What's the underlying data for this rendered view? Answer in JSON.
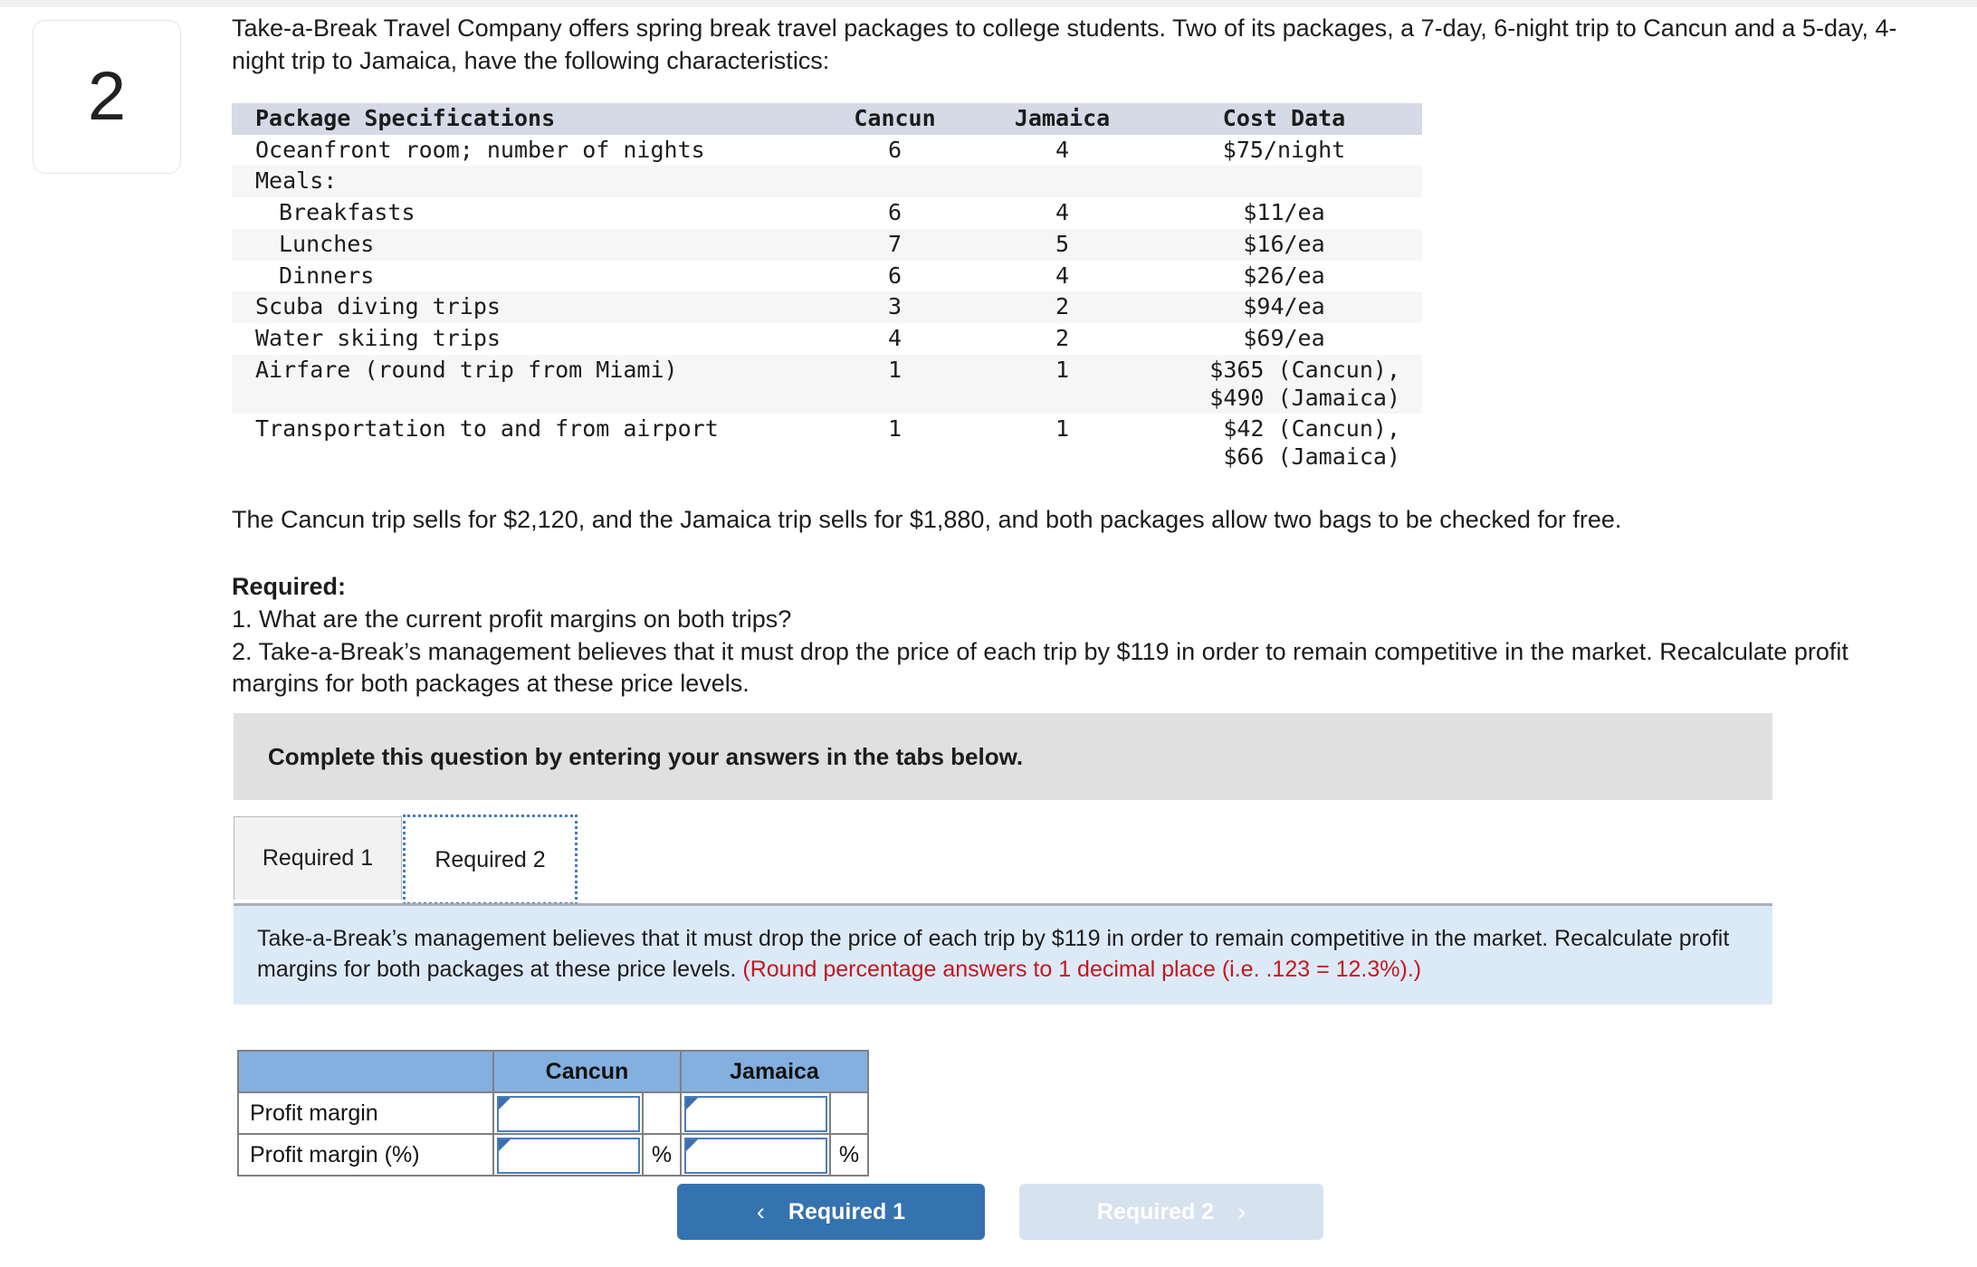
{
  "question": {
    "number": "2"
  },
  "intro": {
    "text": "Take-a-Break Travel Company offers spring break travel packages to college students. Two of its packages, a 7-day, 6-night trip to Cancun and a 5-day, 4-night trip to Jamaica, have the following characteristics:"
  },
  "spec_table": {
    "headers": [
      "Package Specifications",
      "Cancun",
      "Jamaica",
      "Cost Data"
    ],
    "rows": [
      {
        "desc": "Oceanfront room; number of nights",
        "indent": 0,
        "cancun": "6",
        "jamaica": "4",
        "cost": "$75/night",
        "cost2": ""
      },
      {
        "desc": "Meals:",
        "indent": 0,
        "cancun": "",
        "jamaica": "",
        "cost": "",
        "cost2": ""
      },
      {
        "desc": "Breakfasts",
        "indent": 1,
        "cancun": "6",
        "jamaica": "4",
        "cost": "$11/ea",
        "cost2": ""
      },
      {
        "desc": "Lunches",
        "indent": 1,
        "cancun": "7",
        "jamaica": "5",
        "cost": "$16/ea",
        "cost2": ""
      },
      {
        "desc": "Dinners",
        "indent": 1,
        "cancun": "6",
        "jamaica": "4",
        "cost": "$26/ea",
        "cost2": ""
      },
      {
        "desc": "Scuba diving trips",
        "indent": 0,
        "cancun": "3",
        "jamaica": "2",
        "cost": "$94/ea",
        "cost2": ""
      },
      {
        "desc": "Water skiing trips",
        "indent": 0,
        "cancun": "4",
        "jamaica": "2",
        "cost": "$69/ea",
        "cost2": ""
      },
      {
        "desc": "Airfare (round trip from Miami)",
        "indent": 0,
        "cancun": "1",
        "jamaica": "1",
        "cost": "$365 (Cancun),",
        "cost2": "$490 (Jamaica)"
      },
      {
        "desc": "Transportation to and from airport",
        "indent": 0,
        "cancun": "1",
        "jamaica": "1",
        "cost": "$42 (Cancun),",
        "cost2": "$66 (Jamaica)"
      }
    ]
  },
  "sell_line": "The Cancun trip sells for $2,120, and the Jamaica trip sells for $1,880, and both packages allow two bags to be checked for free.",
  "required": {
    "heading": "Required:",
    "item1": "1. What are the current profit margins on both trips?",
    "item2": "2. Take-a-Break’s management believes that it must drop the price of each trip by $119 in order to remain competitive in the market. Recalculate profit margins for both packages at these price levels."
  },
  "banner": {
    "text": "Complete this question by entering your answers in the tabs below."
  },
  "tabs": [
    {
      "label": "Required 1",
      "active": false
    },
    {
      "label": "Required 2",
      "active": true
    }
  ],
  "info_panel": {
    "text_black": "Take-a-Break’s management believes that it must drop the price of each trip by $119 in order to remain competitive in the market. Recalculate profit margins for both packages at these price levels. ",
    "text_red": "(Round percentage answers to 1 decimal place (i.e. .123 = 12.3%).)"
  },
  "answer_grid": {
    "headers": [
      "",
      "Cancun",
      "Jamaica"
    ],
    "rows": [
      {
        "label": "Profit margin",
        "cancun_value": "",
        "cancun_suffix": "",
        "jamaica_value": "",
        "jamaica_suffix": ""
      },
      {
        "label": "Profit margin (%)",
        "cancun_value": "",
        "cancun_suffix": "%",
        "jamaica_value": "",
        "jamaica_suffix": "%"
      }
    ]
  },
  "nav": {
    "prev_label": "Required 1",
    "prev_icon": "chevron-left",
    "prev_glyph": "‹",
    "next_label": "Required 2",
    "next_icon": "chevron-right",
    "next_glyph": "›"
  },
  "colors": {
    "accent_blue": "#3572b0",
    "disabled_blue": "#d7e2ef",
    "info_panel_bg": "#dceaf7",
    "banner_bg": "#e0e0e0",
    "grid_header_blue": "#84b0e0",
    "spec_header_bg": "#d4dae6",
    "red_note": "#c8161d",
    "input_border": "#4a7ebb"
  }
}
